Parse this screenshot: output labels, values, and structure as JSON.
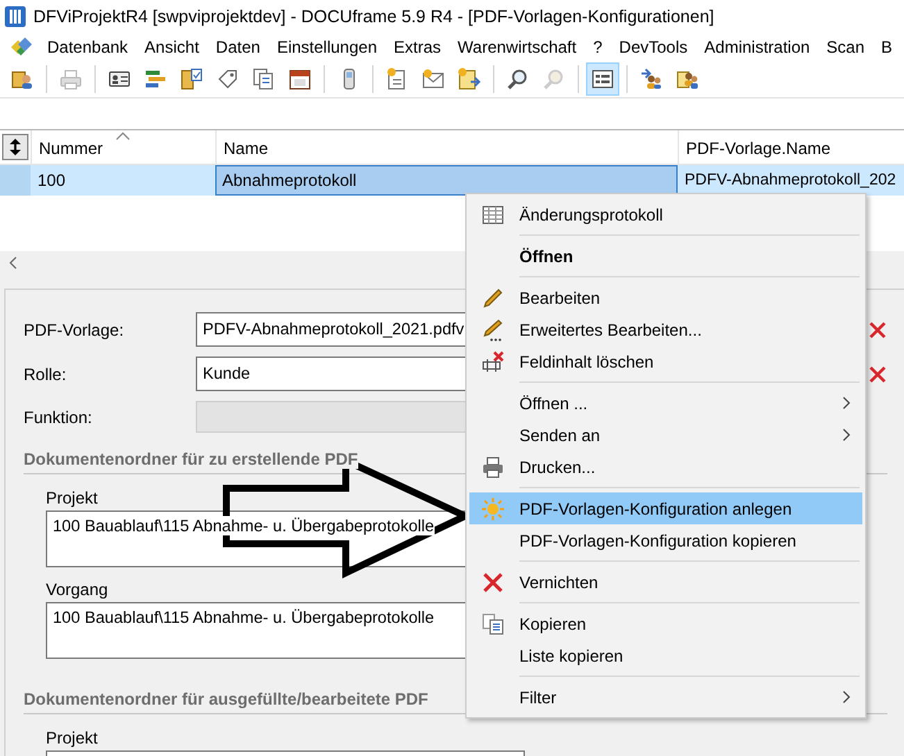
{
  "window": {
    "title": "DFViProjektR4 [swpviprojektdev] - DOCUframe 5.9 R4 - [PDF-Vorlagen-Konfigurationen]"
  },
  "menu_bar": [
    "Datenbank",
    "Ansicht",
    "Daten",
    "Einstellungen",
    "Extras",
    "Warenwirtschaft",
    "?",
    "DevTools",
    "Administration",
    "Scan",
    "B"
  ],
  "toolbar": {
    "list_view_pressed": true
  },
  "table": {
    "columns": [
      {
        "label": "Nummer",
        "sorted": true
      },
      {
        "label": "Name",
        "sorted": false
      },
      {
        "label": "PDF-Vorlage.Name",
        "sorted": false
      }
    ],
    "rows": [
      {
        "selected": true,
        "cells": [
          {
            "text": "100",
            "focused": false
          },
          {
            "text": "Abnahmeprotokoll",
            "focused": true
          },
          {
            "text": "PDFV-Abnahmeprotokoll_202",
            "focused": false
          }
        ]
      }
    ]
  },
  "form": {
    "fields": [
      {
        "label": "PDF-Vorlage:",
        "value": "PDFV-Abnahmeprotokoll_2021.pdfv",
        "disabled": false,
        "clearable": true
      },
      {
        "label": "Rolle:",
        "value": "Kunde",
        "disabled": false,
        "clearable": true
      },
      {
        "label": "Funktion:",
        "disabled": true,
        "clearable": false
      }
    ],
    "sections": [
      {
        "title": "Dokumentenordner für zu erstellende PDF",
        "fields": [
          {
            "label": "Projekt",
            "value": "100 Bauablauf\\115 Abnahme- u. Übergabeprotokolle"
          },
          {
            "label": "Vorgang",
            "value": "100 Bauablauf\\115 Abnahme- u. Übergabeprotokolle"
          }
        ]
      },
      {
        "title": "Dokumentenordner für ausgefüllte/bearbeitete PDF",
        "fields": [
          {
            "label": "Projekt"
          }
        ]
      }
    ]
  },
  "context_menu": [
    {
      "kind": "item",
      "label": "Änderungsprotokoll",
      "bold": false,
      "submenu": false,
      "selected": false
    },
    {
      "kind": "separator"
    },
    {
      "kind": "item",
      "label": "Öffnen",
      "bold": true,
      "submenu": false,
      "selected": false
    },
    {
      "kind": "separator"
    },
    {
      "kind": "item",
      "label": "Bearbeiten",
      "bold": false,
      "submenu": false,
      "selected": false
    },
    {
      "kind": "item",
      "label": "Erweitertes Bearbeiten...",
      "bold": false,
      "submenu": false,
      "selected": false
    },
    {
      "kind": "item",
      "label": "Feldinhalt löschen",
      "bold": false,
      "submenu": false,
      "selected": false
    },
    {
      "kind": "separator"
    },
    {
      "kind": "item",
      "label": "Öffnen ...",
      "bold": false,
      "submenu": true,
      "selected": false
    },
    {
      "kind": "item",
      "label": "Senden an",
      "bold": false,
      "submenu": true,
      "selected": false
    },
    {
      "kind": "item",
      "label": "Drucken...",
      "bold": false,
      "submenu": false,
      "selected": false
    },
    {
      "kind": "separator"
    },
    {
      "kind": "item",
      "label": "PDF-Vorlagen-Konfiguration anlegen",
      "bold": false,
      "submenu": false,
      "selected": true
    },
    {
      "kind": "item",
      "label": "PDF-Vorlagen-Konfiguration kopieren",
      "bold": false,
      "submenu": false,
      "selected": false
    },
    {
      "kind": "separator"
    },
    {
      "kind": "item",
      "label": "Vernichten",
      "bold": false,
      "submenu": false,
      "selected": false
    },
    {
      "kind": "separator"
    },
    {
      "kind": "item",
      "label": "Kopieren",
      "bold": false,
      "submenu": false,
      "selected": false
    },
    {
      "kind": "item",
      "label": "Liste kopieren",
      "bold": false,
      "submenu": false,
      "selected": false
    },
    {
      "kind": "separator"
    },
    {
      "kind": "item",
      "label": "Filter",
      "bold": false,
      "submenu": true,
      "selected": false
    }
  ]
}
